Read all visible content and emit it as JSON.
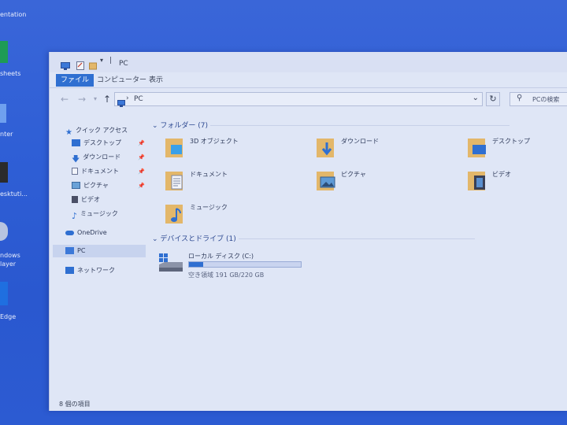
{
  "desktop": {
    "labels": [
      "entation",
      "sheets",
      "nter",
      "esktuti...",
      "ndows",
      "layer",
      "Edge"
    ]
  },
  "window": {
    "title": "PC",
    "ribbon_tabs": [
      "ファイル",
      "コンピューター",
      "表示"
    ],
    "address": "PC",
    "search_placeholder": "PCの検索",
    "nav": {
      "quick_access": "クイック アクセス",
      "quick_items": [
        "デスクトップ",
        "ダウンロード",
        "ドキュメント",
        "ピクチャ",
        "ビデオ",
        "ミュージック"
      ],
      "onedrive": "OneDrive",
      "pc": "PC",
      "network": "ネットワーク"
    },
    "folders_header": "フォルダー (7)",
    "folders": [
      "3D オブジェクト",
      "ダウンロード",
      "デスクトップ",
      "ドキュメント",
      "ピクチャ",
      "ビデオ",
      "ミュージック"
    ],
    "devices_header": "デバイスとドライブ (1)",
    "drive": {
      "name": "ローカル ディスク (C:)",
      "free_text": "空き領域 191 GB/220 GB",
      "used_fraction": 0.13
    },
    "status": "8 個の項目"
  },
  "colors": {
    "accent": "#2f6fd1",
    "folder": "#e3b76a",
    "desktop": "#2f5fd6"
  }
}
